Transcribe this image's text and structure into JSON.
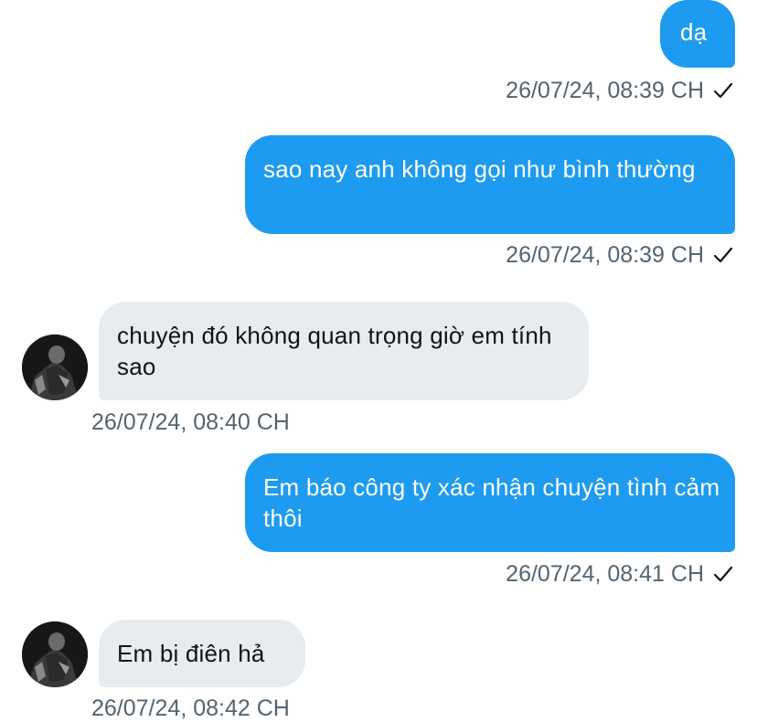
{
  "messages": [
    {
      "direction": "out",
      "text": "dạ",
      "timestamp": "26/07/24, 08:39 CH",
      "read_icon": "check-icon"
    },
    {
      "direction": "out",
      "text": "sao nay anh không gọi như bình thường",
      "timestamp": "26/07/24, 08:39 CH",
      "read_icon": "check-icon"
    },
    {
      "direction": "in",
      "text": " chuyện đó không quan trọng giờ em tính sao",
      "timestamp": "26/07/24, 08:40 CH",
      "avatar": "contact-avatar"
    },
    {
      "direction": "out",
      "text": "Em báo công ty xác nhận chuyện tình cảm thôi",
      "timestamp": "26/07/24, 08:41 CH",
      "read_icon": "check-icon"
    },
    {
      "direction": "in",
      "text": "Em bị điên hả",
      "timestamp": "26/07/24, 08:42 CH",
      "avatar": "contact-avatar"
    }
  ],
  "colors": {
    "outgoing_bubble": "#1d9bf0",
    "incoming_bubble": "#e7ecf0",
    "timestamp_text": "#536471"
  }
}
